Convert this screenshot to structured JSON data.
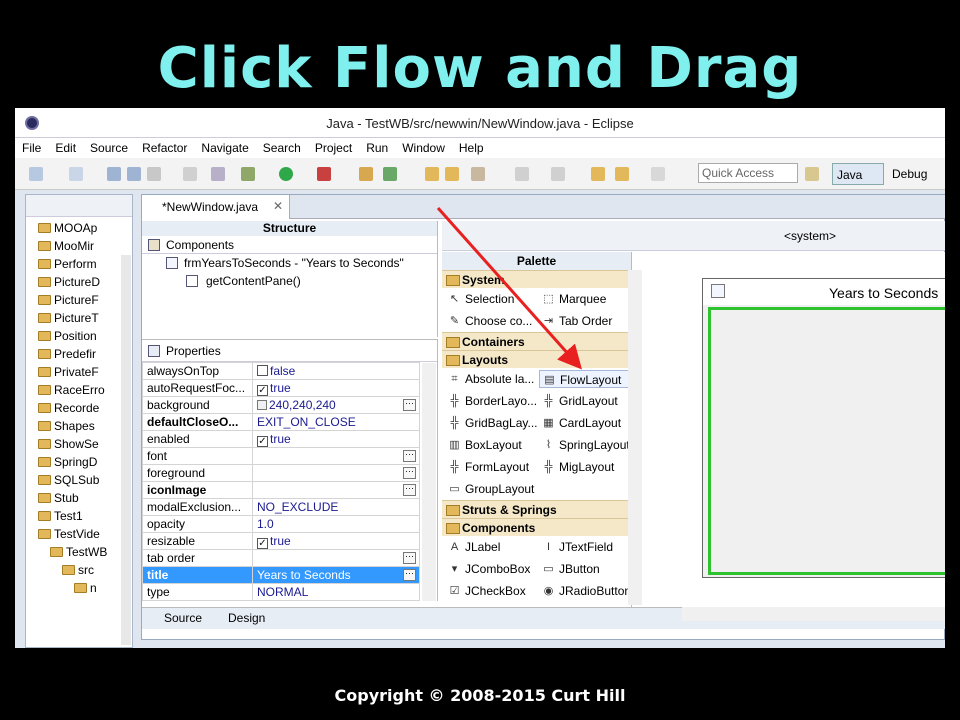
{
  "slide": {
    "title": "Click Flow and Drag",
    "footer": "Copyright © 2008-2015 Curt Hill"
  },
  "window": {
    "title": "Java - TestWB/src/newwin/NewWindow.java - Eclipse"
  },
  "menu": [
    "File",
    "Edit",
    "Source",
    "Refactor",
    "Navigate",
    "Search",
    "Project",
    "Run",
    "Window",
    "Help"
  ],
  "toolbar": {
    "quick_access_placeholder": "Quick Access",
    "perspective_java": "Java",
    "perspective_debug": "Debug"
  },
  "package_explorer": {
    "items": [
      "MOOAp",
      "MooMir",
      "Perform",
      "PictureD",
      "PictureF",
      "PictureT",
      "Position",
      "Predefir",
      "PrivateF",
      "RaceErro",
      "Recorde",
      "Shapes",
      "ShowSe",
      "SpringD",
      "SQLSub",
      "Stub",
      "Test1",
      "TestVide",
      "TestWB",
      "src",
      "n"
    ]
  },
  "editor": {
    "tab_label": "*NewWindow.java",
    "structure_label": "Structure",
    "components_label": "Components",
    "tree": [
      "frmYearsToSeconds - \"Years to Seconds\"",
      "getContentPane()"
    ],
    "properties_label": "Properties",
    "properties": [
      {
        "name": "alwaysOnTop",
        "value": "false",
        "check": "unchecked"
      },
      {
        "name": "autoRequestFoc...",
        "value": "true",
        "check": "checked"
      },
      {
        "name": "background",
        "value": "240,240,240",
        "swatch": true,
        "dots": true
      },
      {
        "name": "defaultCloseO...",
        "value": "EXIT_ON_CLOSE",
        "bold": true
      },
      {
        "name": "enabled",
        "value": "true",
        "check": "checked"
      },
      {
        "name": "font",
        "value": "",
        "dots": true
      },
      {
        "name": "foreground",
        "value": "",
        "dots": true
      },
      {
        "name": "iconImage",
        "value": "",
        "bold": true,
        "dots": true
      },
      {
        "name": "modalExclusion...",
        "value": "NO_EXCLUDE"
      },
      {
        "name": "opacity",
        "value": "1.0"
      },
      {
        "name": "resizable",
        "value": "true",
        "check": "checked"
      },
      {
        "name": "tab order",
        "value": "",
        "dots": true
      },
      {
        "name": "title",
        "value": "Years to Seconds",
        "bold": true,
        "selected": true,
        "dots": true
      },
      {
        "name": "type",
        "value": "NORMAL"
      }
    ],
    "source_tab": "Source",
    "design_tab": "Design",
    "system_selector": "<system>",
    "palette": {
      "title": "Palette",
      "categories": {
        "system": "System",
        "containers": "Containers",
        "layouts": "Layouts",
        "struts": "Struts & Springs",
        "components": "Components"
      },
      "system_items": [
        "Selection",
        "Marquee",
        "Choose co...",
        "Tab Order"
      ],
      "layout_items": [
        "Absolute la...",
        "FlowLayout",
        "BorderLayo...",
        "GridLayout",
        "GridBagLay...",
        "CardLayout",
        "BoxLayout",
        "SpringLayout",
        "FormLayout",
        "MigLayout",
        "GroupLayout"
      ],
      "component_items": [
        "JLabel",
        "JTextField",
        "JComboBox",
        "JButton",
        "JCheckBox",
        "JRadioButton"
      ]
    },
    "frame_title": "Years to Seconds"
  },
  "colors": {
    "slide_title": "#7ff0ee",
    "annotation_arrow": "#e82020",
    "selection": "#3399ff",
    "frame_border": "#2ec22e"
  }
}
